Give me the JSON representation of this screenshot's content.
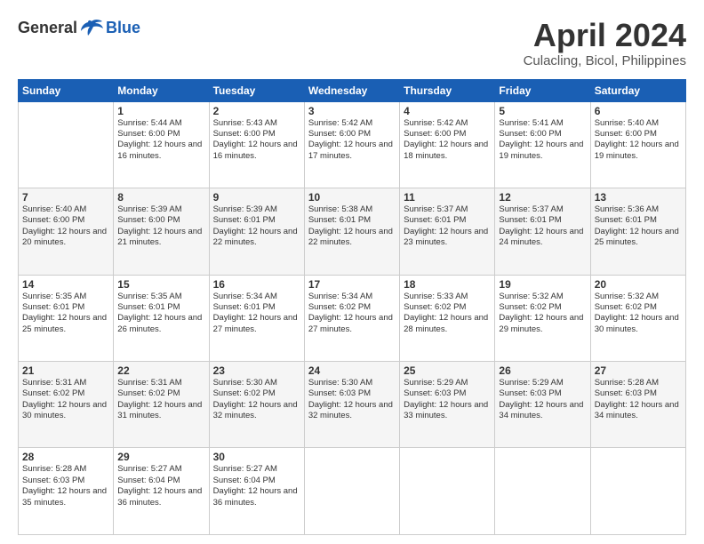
{
  "header": {
    "logo": {
      "general": "General",
      "blue": "Blue"
    },
    "title": "April 2024",
    "location": "Culacling, Bicol, Philippines"
  },
  "weekdays": [
    "Sunday",
    "Monday",
    "Tuesday",
    "Wednesday",
    "Thursday",
    "Friday",
    "Saturday"
  ],
  "weeks": [
    [
      {
        "day": "",
        "sunrise": "",
        "sunset": "",
        "daylight": ""
      },
      {
        "day": "1",
        "sunrise": "Sunrise: 5:44 AM",
        "sunset": "Sunset: 6:00 PM",
        "daylight": "Daylight: 12 hours and 16 minutes."
      },
      {
        "day": "2",
        "sunrise": "Sunrise: 5:43 AM",
        "sunset": "Sunset: 6:00 PM",
        "daylight": "Daylight: 12 hours and 16 minutes."
      },
      {
        "day": "3",
        "sunrise": "Sunrise: 5:42 AM",
        "sunset": "Sunset: 6:00 PM",
        "daylight": "Daylight: 12 hours and 17 minutes."
      },
      {
        "day": "4",
        "sunrise": "Sunrise: 5:42 AM",
        "sunset": "Sunset: 6:00 PM",
        "daylight": "Daylight: 12 hours and 18 minutes."
      },
      {
        "day": "5",
        "sunrise": "Sunrise: 5:41 AM",
        "sunset": "Sunset: 6:00 PM",
        "daylight": "Daylight: 12 hours and 19 minutes."
      },
      {
        "day": "6",
        "sunrise": "Sunrise: 5:40 AM",
        "sunset": "Sunset: 6:00 PM",
        "daylight": "Daylight: 12 hours and 19 minutes."
      }
    ],
    [
      {
        "day": "7",
        "sunrise": "Sunrise: 5:40 AM",
        "sunset": "Sunset: 6:00 PM",
        "daylight": "Daylight: 12 hours and 20 minutes."
      },
      {
        "day": "8",
        "sunrise": "Sunrise: 5:39 AM",
        "sunset": "Sunset: 6:00 PM",
        "daylight": "Daylight: 12 hours and 21 minutes."
      },
      {
        "day": "9",
        "sunrise": "Sunrise: 5:39 AM",
        "sunset": "Sunset: 6:01 PM",
        "daylight": "Daylight: 12 hours and 22 minutes."
      },
      {
        "day": "10",
        "sunrise": "Sunrise: 5:38 AM",
        "sunset": "Sunset: 6:01 PM",
        "daylight": "Daylight: 12 hours and 22 minutes."
      },
      {
        "day": "11",
        "sunrise": "Sunrise: 5:37 AM",
        "sunset": "Sunset: 6:01 PM",
        "daylight": "Daylight: 12 hours and 23 minutes."
      },
      {
        "day": "12",
        "sunrise": "Sunrise: 5:37 AM",
        "sunset": "Sunset: 6:01 PM",
        "daylight": "Daylight: 12 hours and 24 minutes."
      },
      {
        "day": "13",
        "sunrise": "Sunrise: 5:36 AM",
        "sunset": "Sunset: 6:01 PM",
        "daylight": "Daylight: 12 hours and 25 minutes."
      }
    ],
    [
      {
        "day": "14",
        "sunrise": "Sunrise: 5:35 AM",
        "sunset": "Sunset: 6:01 PM",
        "daylight": "Daylight: 12 hours and 25 minutes."
      },
      {
        "day": "15",
        "sunrise": "Sunrise: 5:35 AM",
        "sunset": "Sunset: 6:01 PM",
        "daylight": "Daylight: 12 hours and 26 minutes."
      },
      {
        "day": "16",
        "sunrise": "Sunrise: 5:34 AM",
        "sunset": "Sunset: 6:01 PM",
        "daylight": "Daylight: 12 hours and 27 minutes."
      },
      {
        "day": "17",
        "sunrise": "Sunrise: 5:34 AM",
        "sunset": "Sunset: 6:02 PM",
        "daylight": "Daylight: 12 hours and 27 minutes."
      },
      {
        "day": "18",
        "sunrise": "Sunrise: 5:33 AM",
        "sunset": "Sunset: 6:02 PM",
        "daylight": "Daylight: 12 hours and 28 minutes."
      },
      {
        "day": "19",
        "sunrise": "Sunrise: 5:32 AM",
        "sunset": "Sunset: 6:02 PM",
        "daylight": "Daylight: 12 hours and 29 minutes."
      },
      {
        "day": "20",
        "sunrise": "Sunrise: 5:32 AM",
        "sunset": "Sunset: 6:02 PM",
        "daylight": "Daylight: 12 hours and 30 minutes."
      }
    ],
    [
      {
        "day": "21",
        "sunrise": "Sunrise: 5:31 AM",
        "sunset": "Sunset: 6:02 PM",
        "daylight": "Daylight: 12 hours and 30 minutes."
      },
      {
        "day": "22",
        "sunrise": "Sunrise: 5:31 AM",
        "sunset": "Sunset: 6:02 PM",
        "daylight": "Daylight: 12 hours and 31 minutes."
      },
      {
        "day": "23",
        "sunrise": "Sunrise: 5:30 AM",
        "sunset": "Sunset: 6:02 PM",
        "daylight": "Daylight: 12 hours and 32 minutes."
      },
      {
        "day": "24",
        "sunrise": "Sunrise: 5:30 AM",
        "sunset": "Sunset: 6:03 PM",
        "daylight": "Daylight: 12 hours and 32 minutes."
      },
      {
        "day": "25",
        "sunrise": "Sunrise: 5:29 AM",
        "sunset": "Sunset: 6:03 PM",
        "daylight": "Daylight: 12 hours and 33 minutes."
      },
      {
        "day": "26",
        "sunrise": "Sunrise: 5:29 AM",
        "sunset": "Sunset: 6:03 PM",
        "daylight": "Daylight: 12 hours and 34 minutes."
      },
      {
        "day": "27",
        "sunrise": "Sunrise: 5:28 AM",
        "sunset": "Sunset: 6:03 PM",
        "daylight": "Daylight: 12 hours and 34 minutes."
      }
    ],
    [
      {
        "day": "28",
        "sunrise": "Sunrise: 5:28 AM",
        "sunset": "Sunset: 6:03 PM",
        "daylight": "Daylight: 12 hours and 35 minutes."
      },
      {
        "day": "29",
        "sunrise": "Sunrise: 5:27 AM",
        "sunset": "Sunset: 6:04 PM",
        "daylight": "Daylight: 12 hours and 36 minutes."
      },
      {
        "day": "30",
        "sunrise": "Sunrise: 5:27 AM",
        "sunset": "Sunset: 6:04 PM",
        "daylight": "Daylight: 12 hours and 36 minutes."
      },
      {
        "day": "",
        "sunrise": "",
        "sunset": "",
        "daylight": ""
      },
      {
        "day": "",
        "sunrise": "",
        "sunset": "",
        "daylight": ""
      },
      {
        "day": "",
        "sunrise": "",
        "sunset": "",
        "daylight": ""
      },
      {
        "day": "",
        "sunrise": "",
        "sunset": "",
        "daylight": ""
      }
    ]
  ]
}
